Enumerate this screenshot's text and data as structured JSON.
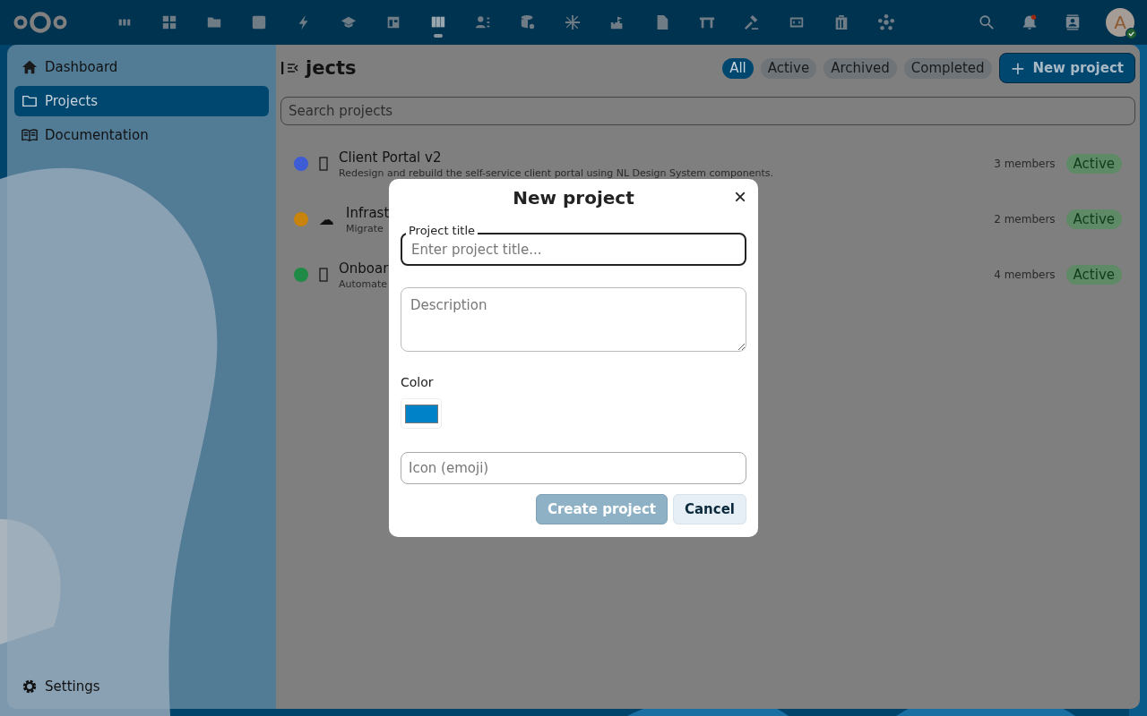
{
  "header": {
    "apps": [
      {
        "selected": false
      },
      {
        "selected": false
      },
      {
        "selected": false
      },
      {
        "selected": false
      },
      {
        "selected": false
      },
      {
        "selected": false
      },
      {
        "selected": false
      },
      {
        "selected": true
      },
      {
        "selected": false
      },
      {
        "selected": false
      },
      {
        "selected": false
      },
      {
        "selected": false
      },
      {
        "selected": false
      },
      {
        "selected": false
      },
      {
        "selected": false
      },
      {
        "selected": false
      },
      {
        "selected": false
      },
      {
        "selected": false
      }
    ],
    "notifications": {
      "unread": true
    },
    "avatar": {
      "initial": "A",
      "online": true
    }
  },
  "sidebar": {
    "items": [
      {
        "kind": "home",
        "label": "Dashboard",
        "selected": false
      },
      {
        "kind": "folder",
        "label": "Projects",
        "selected": true
      },
      {
        "kind": "book",
        "label": "Documentation",
        "selected": false
      }
    ],
    "settings": "Settings"
  },
  "page": {
    "title": "jects",
    "filters": [
      {
        "label": "All",
        "selected": true
      },
      {
        "label": "Active",
        "selected": false
      },
      {
        "label": "Archived",
        "selected": false
      },
      {
        "label": "Completed",
        "selected": false
      }
    ],
    "new_button": {
      "icon": "+",
      "label": "New project"
    },
    "search": {
      "placeholder": "Search projects"
    },
    "projects": [
      {
        "title": "Client Portal v2",
        "description": "Redesign and rebuild the self-service client portal using NL Design System components.",
        "color": "#3d5cd6",
        "members": "3 members",
        "status": "Active"
      },
      {
        "title": "Infrast",
        "description": "Migrate",
        "icon": "☁",
        "color": "#c8830c",
        "members": "2 members",
        "status": "Active"
      },
      {
        "title": "Onboar",
        "description": "Automate",
        "color": "#1e8a45",
        "members": "4 members",
        "status": "Active"
      }
    ]
  },
  "dialog": {
    "title": "New project",
    "close": "×",
    "title_field": {
      "label": "Project title",
      "placeholder": "Enter project title..."
    },
    "description_field": {
      "placeholder": "Description"
    },
    "color_label": "Color",
    "color": "#0082c9",
    "icon_field": {
      "placeholder": "Icon (emoji)"
    },
    "buttons": [
      {
        "kind": "primary",
        "label": "Create project",
        "disabled": true
      },
      {
        "kind": "secondary",
        "label": "Cancel",
        "disabled": false
      }
    ]
  }
}
